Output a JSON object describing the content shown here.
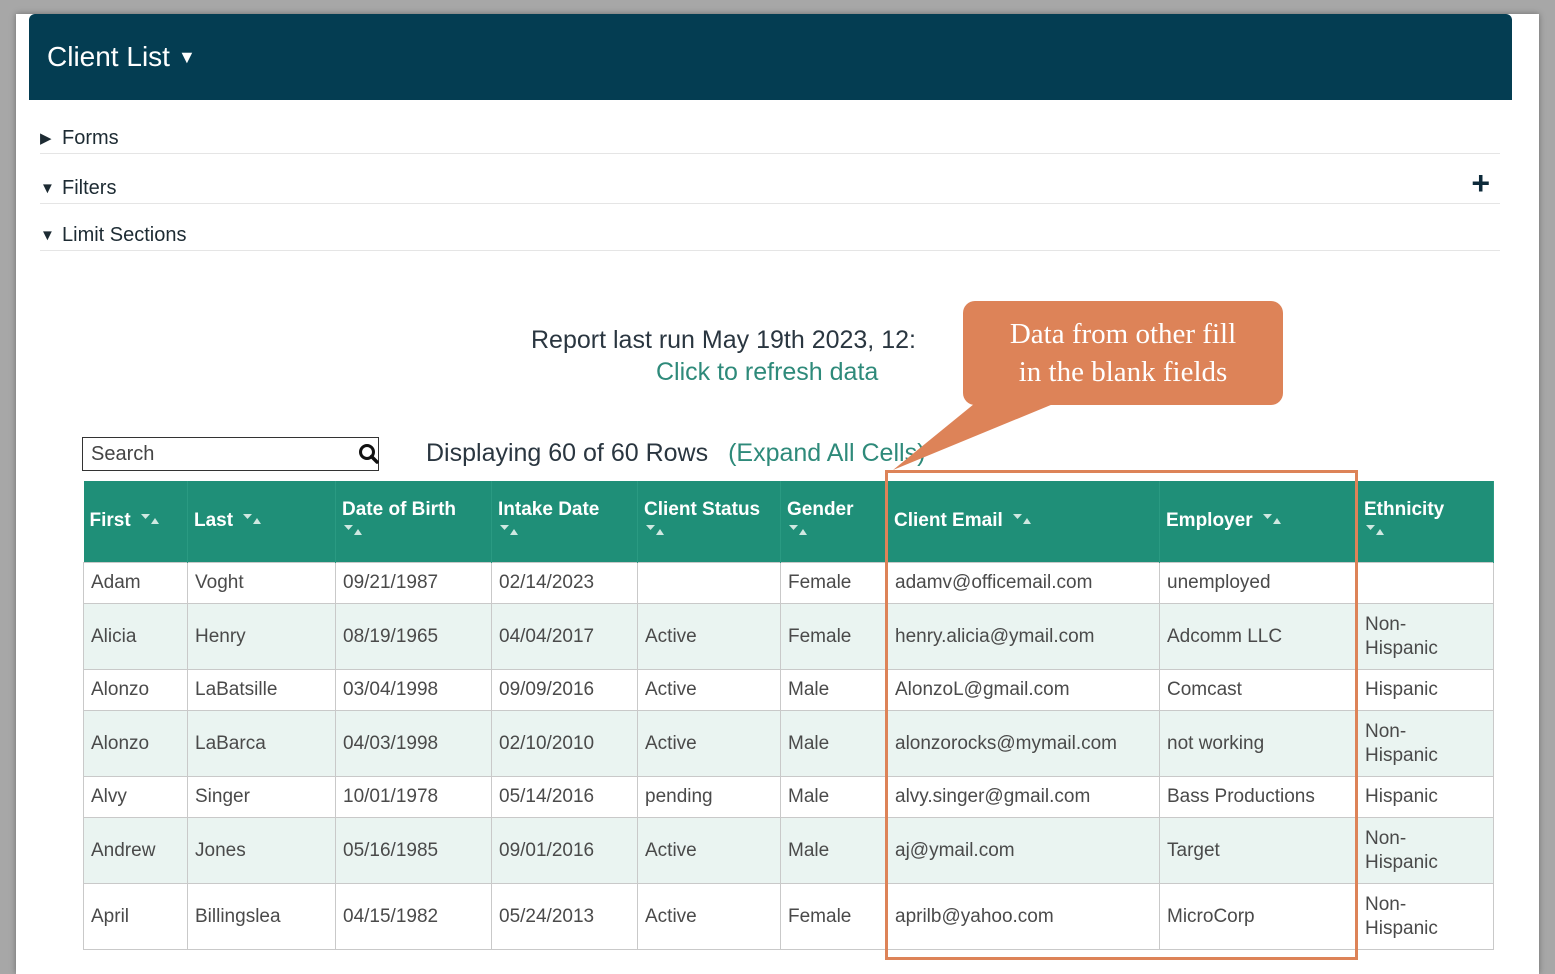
{
  "header": {
    "title": "Client List"
  },
  "sections": {
    "forms": "Forms",
    "filters": "Filters",
    "limit_sections": "Limit Sections"
  },
  "report": {
    "last_run": "Report last run May 19th 2023, 12:",
    "refresh": "Click to refresh data"
  },
  "search": {
    "placeholder": "Search"
  },
  "rows_info": {
    "text": "Displaying 60 of 60 Rows",
    "expand": "(Expand All Cells)"
  },
  "callout": {
    "line1": "Data from other fill",
    "line2": "in the blank fields"
  },
  "table": {
    "headers": [
      "First",
      "Last",
      "Date of Birth",
      "Intake Date",
      "Client Status",
      "Gender",
      "Client Email",
      "Employer",
      "Ethnicity"
    ],
    "rows": [
      [
        "Adam",
        "Voght",
        "09/21/1987",
        "02/14/2023",
        "",
        "Female",
        "adamv@officemail.com",
        "unemployed",
        ""
      ],
      [
        "Alicia",
        "Henry",
        "08/19/1965",
        "04/04/2017",
        "Active",
        "Female",
        "henry.alicia@ymail.com",
        "Adcomm LLC",
        "Non-Hispanic"
      ],
      [
        "Alonzo",
        "LaBatsille",
        "03/04/1998",
        "09/09/2016",
        "Active",
        "Male",
        "AlonzoL@gmail.com",
        "Comcast",
        "Hispanic"
      ],
      [
        "Alonzo",
        "LaBarca",
        "04/03/1998",
        "02/10/2010",
        "Active",
        "Male",
        "alonzorocks@mymail.com",
        "not working",
        "Non-Hispanic"
      ],
      [
        "Alvy",
        "Singer",
        "10/01/1978",
        "05/14/2016",
        "pending",
        "Male",
        "alvy.singer@gmail.com",
        "Bass Productions",
        "Hispanic"
      ],
      [
        "Andrew",
        "Jones",
        "05/16/1985",
        "09/01/2016",
        "Active",
        "Male",
        "aj@ymail.com",
        "Target",
        "Non-Hispanic"
      ],
      [
        "April",
        "Billingslea",
        "04/15/1982",
        "05/24/2013",
        "Active",
        "Female",
        "aprilb@yahoo.com",
        "MicroCorp",
        "Non-Hispanic"
      ]
    ]
  }
}
